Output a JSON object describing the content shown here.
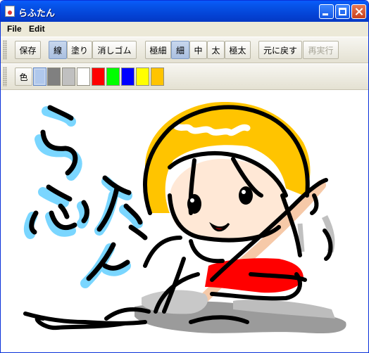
{
  "window": {
    "title": "らふたん"
  },
  "menu": {
    "items": [
      "File",
      "Edit"
    ]
  },
  "toolbar": {
    "save": "保存",
    "tools": [
      "線",
      "塗り",
      "消しゴム"
    ],
    "selected_tool": "線",
    "widths": [
      "極細",
      "細",
      "中",
      "太",
      "極太"
    ],
    "selected_width": "細",
    "undo": "元に戻す",
    "redo": "再実行",
    "redo_enabled": false
  },
  "palette": {
    "color_label": "色",
    "colors": [
      "#b0c8ec",
      "#808080",
      "#c0c0c0",
      "#ffffff",
      "#ff0000",
      "#00ff00",
      "#0000ff",
      "#ffff00",
      "#ffc400"
    ],
    "selected_color": "#b0c8ec"
  },
  "canvas": {
    "description_colors": {
      "hair": "#ffc400",
      "skin": "#ffe8d6",
      "dress": "#ff0000",
      "shadow": "#808080",
      "highlight": "#7ad6ff",
      "ink": "#000000"
    }
  }
}
